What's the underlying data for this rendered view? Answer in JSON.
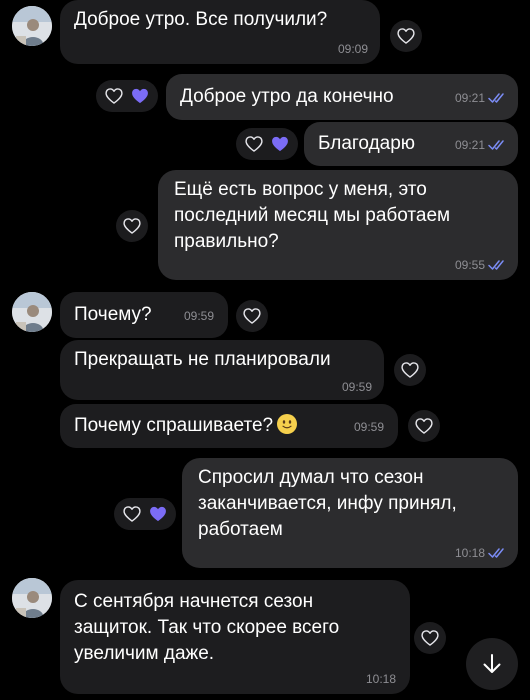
{
  "chat": {
    "messages": [
      {
        "text": "Доброе утро. Все получили?",
        "time": "09:09"
      },
      {
        "text": "Доброе утро да конечно",
        "time": "09:21"
      },
      {
        "text": "Благодарю",
        "time": "09:21"
      },
      {
        "line1": "Ещё есть вопрос у меня, это",
        "line2": "последний месяц мы работаем",
        "line3": "правильно?",
        "time": "09:55"
      },
      {
        "text": "Почему?",
        "time": "09:59"
      },
      {
        "text": "Прекращать не планировали",
        "time": "09:59"
      },
      {
        "text": "Почему спрашиваете?",
        "time": "09:59"
      },
      {
        "line1": "Спросил думал что сезон",
        "line2": "заканчивается, инфу принял,",
        "line3": "работаем",
        "time": "10:18"
      },
      {
        "line1": "С сентября начнется сезон",
        "line2": "защиток. Так что скорее всего",
        "line3": "увеличим даже.",
        "time": "10:18"
      }
    ]
  },
  "icons": {
    "heart_outline": "heart-outline-icon",
    "heart_filled": "heart-filled-icon",
    "read_receipt": "double-check-icon",
    "emoji": "slightly-smiling-emoji",
    "scroll_down": "arrow-down-icon"
  },
  "colors": {
    "background": "#000000",
    "incoming_bubble": "#1d1d1f",
    "outgoing_bubble": "#2c2c2e",
    "accent_purple": "#7b6cf6",
    "read_check": "#7b8cf5"
  }
}
